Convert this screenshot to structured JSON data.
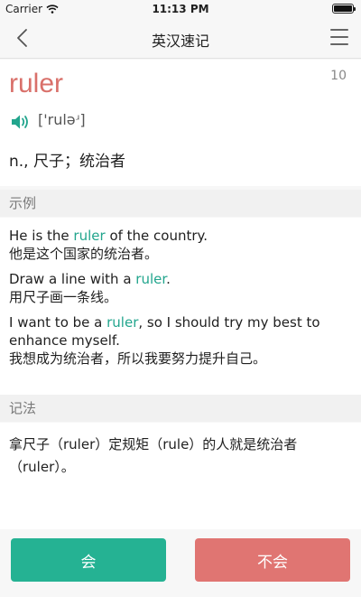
{
  "status_bar": {
    "carrier": "Carrier",
    "time": "11:13 PM"
  },
  "nav": {
    "title": "英汉速记",
    "back_icon": "chevron-left-icon",
    "menu_icon": "hamburger-menu-icon"
  },
  "word": {
    "text": "ruler",
    "count": "10",
    "phonetic": "['ruləʴ]",
    "meaning": "n., 尺子；统治者",
    "speaker_icon": "speaker-icon",
    "word_color": "#d9706a",
    "speaker_color": "#22a58d"
  },
  "examples_section": {
    "title": "示例",
    "items": [
      {
        "en_before": "He is the ",
        "en_highlight": "ruler",
        "en_after": " of the country.",
        "zh": "他是这个国家的统治者。"
      },
      {
        "en_before": "Draw a line with a ",
        "en_highlight": "ruler",
        "en_after": ".",
        "zh": "用尺子画一条线。"
      },
      {
        "en_before": "I want to be a ",
        "en_highlight": "ruler",
        "en_after": ", so I should try my best to enhance myself.",
        "zh": "我想成为统治者，所以我要努力提升自己。"
      }
    ],
    "highlight_color": "#22a58d"
  },
  "memo_section": {
    "title": "记法",
    "text": "拿尺子（ruler）定规矩（rule）的人就是统治者（ruler）。"
  },
  "buttons": {
    "know": "会",
    "dont_know": "不会",
    "know_color": "#25b293",
    "dont_know_color": "#e07572"
  }
}
